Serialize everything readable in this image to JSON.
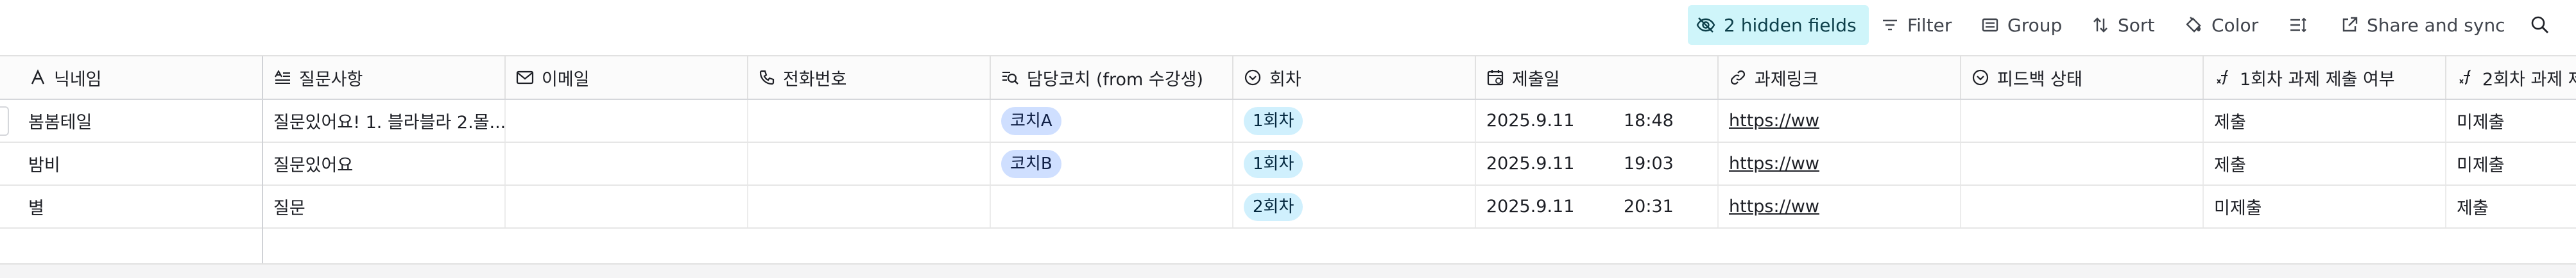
{
  "toolbar": {
    "hidden_fields_label": "2 hidden fields",
    "filter_label": "Filter",
    "group_label": "Group",
    "sort_label": "Sort",
    "color_label": "Color",
    "share_sync_label": "Share and sync"
  },
  "columns": [
    {
      "label": "닉네임",
      "icon": "text-a-icon"
    },
    {
      "label": "질문사항",
      "icon": "long-text-icon"
    },
    {
      "label": "이메일",
      "icon": "email-icon"
    },
    {
      "label": "전화번호",
      "icon": "phone-icon"
    },
    {
      "label": "담당코치 (from 수강생)",
      "icon": "lookup-icon"
    },
    {
      "label": "회차",
      "icon": "single-select-icon"
    },
    {
      "label": "제출일",
      "icon": "date-icon"
    },
    {
      "label": "과제링크",
      "icon": "link-icon"
    },
    {
      "label": "피드백 상태",
      "icon": "single-select-icon"
    },
    {
      "label": "1회차 과제 제출 여부",
      "icon": "formula-icon"
    },
    {
      "label": "2회차 과제 제",
      "icon": "formula-icon"
    }
  ],
  "rows": [
    {
      "nickname": "봄봄테일",
      "question": "질문있어요! 1. 블라블라 2.몰...",
      "coach": "코치A",
      "round": "1회차",
      "date": "2025.9.11",
      "time": "18:48",
      "link": "https://ww",
      "r1": "제출",
      "r2": "미제출"
    },
    {
      "nickname": "밤비",
      "question": "질문있어요",
      "coach": "코치B",
      "round": "1회차",
      "date": "2025.9.11",
      "time": "19:03",
      "link": "https://ww",
      "r1": "제출",
      "r2": "미제출"
    },
    {
      "nickname": "별",
      "question": "질문",
      "coach": "",
      "round": "2회차",
      "date": "2025.9.11",
      "time": "20:31",
      "link": "https://ww",
      "r1": "미제출",
      "r2": "제출"
    }
  ],
  "colors": {
    "active_toolbar_bg": "#cff5fa",
    "coach_pill": "#cfdfff",
    "round_pill": "#d0f0fd"
  }
}
